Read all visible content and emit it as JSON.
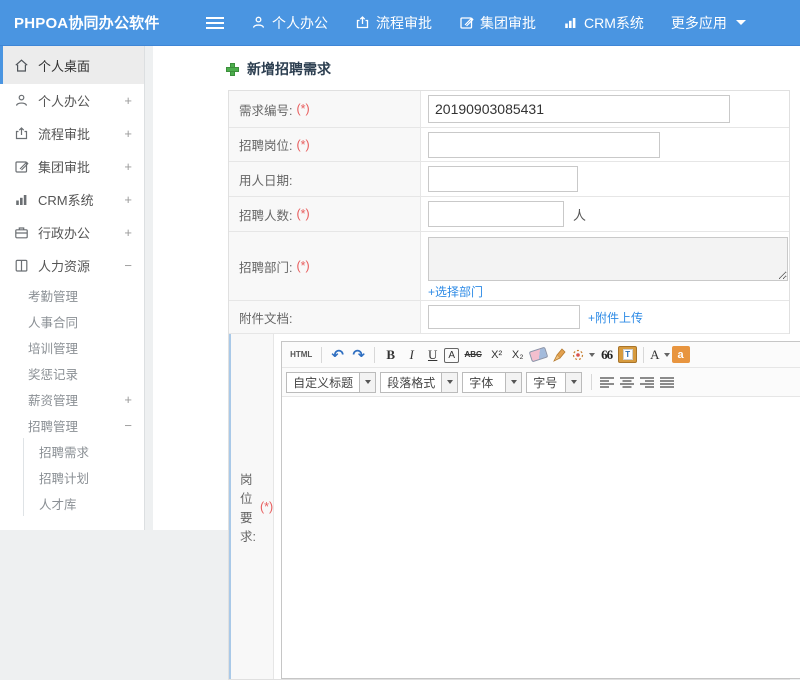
{
  "header": {
    "brand": "PHPOA协同办公软件",
    "nav": [
      {
        "label": "个人办公",
        "icon": "user-icon"
      },
      {
        "label": "流程审批",
        "icon": "flow-approval-icon"
      },
      {
        "label": "集团审批",
        "icon": "group-approval-icon"
      },
      {
        "label": "CRM系统",
        "icon": "crm-chart-icon"
      },
      {
        "label": "更多应用",
        "icon": "caret-down-icon"
      }
    ]
  },
  "sidebar": {
    "items": [
      {
        "label": "个人桌面",
        "icon": "home-icon",
        "active": true
      },
      {
        "label": "个人办公",
        "icon": "user-icon",
        "toggle": "+"
      },
      {
        "label": "流程审批",
        "icon": "flow-approval-icon",
        "toggle": "+"
      },
      {
        "label": "集团审批",
        "icon": "group-approval-icon",
        "toggle": "+"
      },
      {
        "label": "CRM系统",
        "icon": "crm-chart-icon",
        "toggle": "+"
      },
      {
        "label": "行政办公",
        "icon": "briefcase-icon",
        "toggle": "+"
      },
      {
        "label": "人力资源",
        "icon": "book-icon",
        "toggle": "−"
      }
    ],
    "hr_children": [
      {
        "label": "考勤管理"
      },
      {
        "label": "人事合同"
      },
      {
        "label": "培训管理"
      },
      {
        "label": "奖惩记录"
      },
      {
        "label": "薪资管理",
        "toggle": "+"
      },
      {
        "label": "招聘管理",
        "toggle": "−"
      }
    ],
    "recruit_children": [
      {
        "label": "招聘需求"
      },
      {
        "label": "招聘计划"
      },
      {
        "label": "人才库"
      }
    ]
  },
  "main": {
    "page_title": "新增招聘需求",
    "required_mark": "(*)",
    "form": {
      "rows": [
        {
          "label": "需求编号:",
          "required": true,
          "value": "20190903085431"
        },
        {
          "label": "招聘岗位:",
          "required": true,
          "value": ""
        },
        {
          "label": "用人日期:",
          "required": false,
          "value": ""
        },
        {
          "label": "招聘人数:",
          "required": true,
          "value": "",
          "suffix": "人"
        },
        {
          "label": "招聘部门:",
          "required": true,
          "value": "",
          "link": "+选择部门"
        },
        {
          "label": "附件文档:",
          "required": false,
          "value": "",
          "link": "+附件上传"
        },
        {
          "label": "岗位要求:",
          "required": true
        }
      ]
    },
    "editor": {
      "toolbar1": [
        {
          "name": "html-source",
          "glyph": "HTML"
        },
        {
          "name": "undo",
          "glyph": "↶"
        },
        {
          "name": "redo",
          "glyph": "↷"
        },
        {
          "name": "bold",
          "glyph": "B"
        },
        {
          "name": "italic",
          "glyph": "I"
        },
        {
          "name": "underline",
          "glyph": "U"
        },
        {
          "name": "char-border",
          "glyph": "A"
        },
        {
          "name": "strikethrough",
          "glyph": "ABC"
        },
        {
          "name": "superscript",
          "glyph": "X²"
        },
        {
          "name": "subscript",
          "glyph": "X₂"
        },
        {
          "name": "remove-format-eraser",
          "glyph": ""
        },
        {
          "name": "quick-format-broom",
          "glyph": ""
        },
        {
          "name": "format-brush",
          "glyph": ""
        },
        {
          "name": "blockquote",
          "glyph": "66"
        },
        {
          "name": "paste-as-text",
          "glyph": "T"
        },
        {
          "name": "font-color",
          "glyph": "A"
        },
        {
          "name": "background-color",
          "glyph": "a"
        }
      ],
      "toolbar2": {
        "selects": [
          "自定义标题",
          "段落格式",
          "字体",
          "字号"
        ],
        "align_icons": [
          "align-left-icon",
          "align-center-icon",
          "align-right-icon",
          "align-justify-icon"
        ]
      }
    }
  },
  "colors": {
    "header_background": "#4a95e1",
    "accent_blue": "#4a95e1",
    "link_blue": "#2e8be6",
    "required_red": "#e85d5d",
    "title_text": "#2c3e50",
    "plus_green": "#4cae4c"
  }
}
